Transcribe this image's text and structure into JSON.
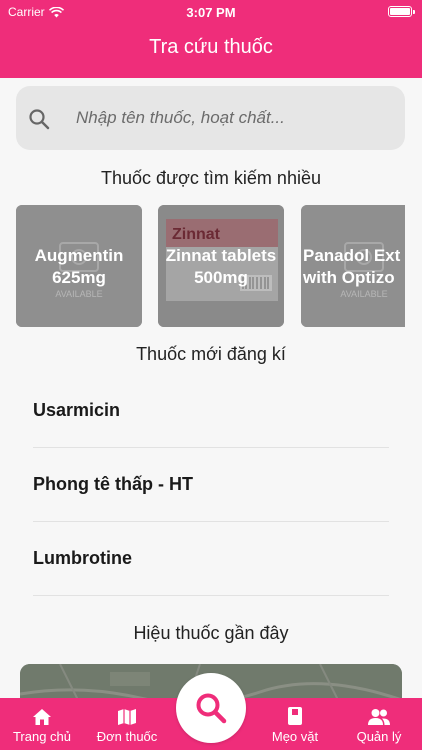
{
  "status_bar": {
    "carrier": "Carrier",
    "time": "3:07 PM"
  },
  "header": {
    "title": "Tra cứu thuốc"
  },
  "search": {
    "placeholder": "Nhập tên thuốc, hoạt chất..."
  },
  "popular": {
    "title": "Thuốc được tìm kiếm nhiều",
    "items": [
      {
        "line1": "Augmentin",
        "line2": "625mg",
        "image_text": "AVAILABLE"
      },
      {
        "line1": "Zinnat tablets",
        "line2": "500mg",
        "image_text": "Zinnat"
      },
      {
        "line1": "Panadol Ext",
        "line2": "with Optizo",
        "image_text": "AVAILABLE"
      }
    ]
  },
  "new_drugs": {
    "title": "Thuốc mới đăng kí",
    "items": [
      "Usarmicin",
      "Phong tê thấp - HT",
      "Lumbrotine"
    ]
  },
  "nearby": {
    "title": "Hiệu thuốc gần đây"
  },
  "tabs": {
    "home": "Trang chủ",
    "prescription": "Đơn thuốc",
    "tips": "Mẹo vặt",
    "manage": "Quản lý"
  },
  "colors": {
    "primary": "#ef2d7a",
    "background": "#f7f7f7"
  }
}
